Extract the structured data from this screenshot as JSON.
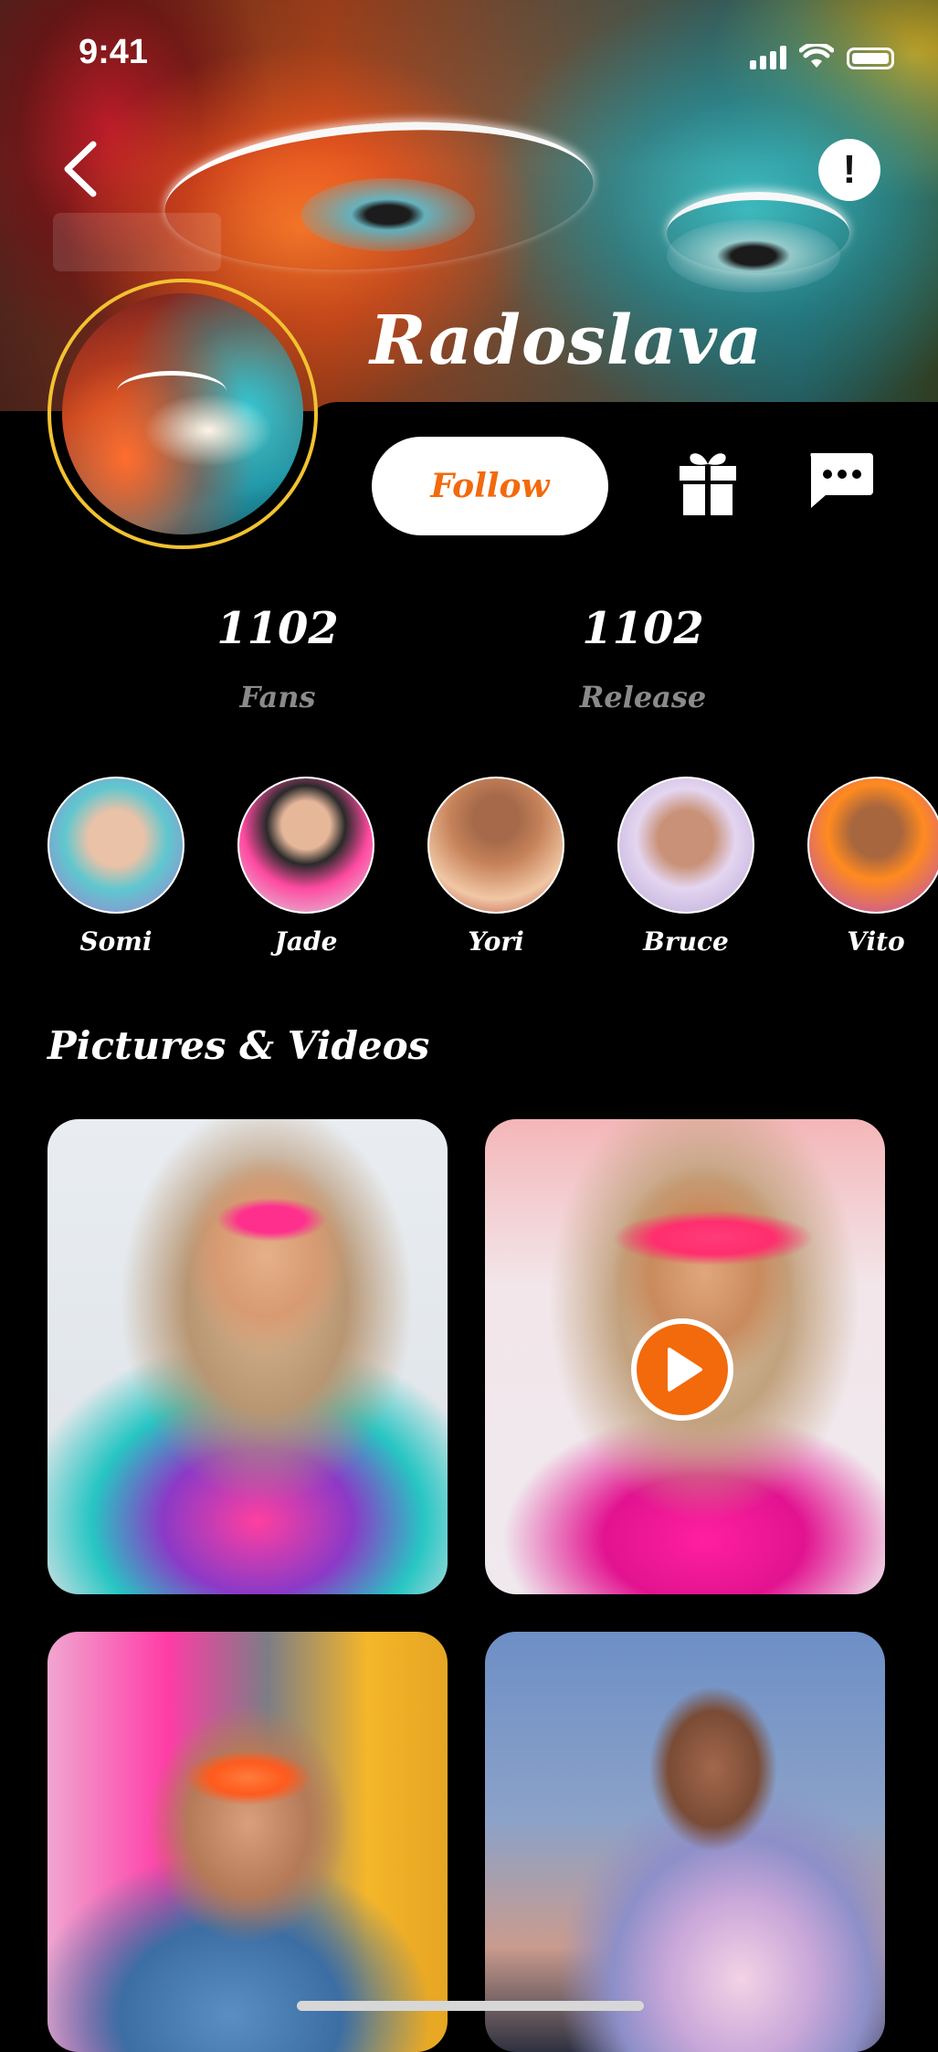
{
  "status_bar": {
    "time": "9:41"
  },
  "profile": {
    "name": "Radoslava",
    "follow_label": "Follow"
  },
  "stats": [
    {
      "value": "1102",
      "label": "Fans"
    },
    {
      "value": "1102",
      "label": "Release"
    }
  ],
  "friends": [
    {
      "name": "Somi",
      "colors": [
        "#5fc7cf",
        "#a777d0"
      ]
    },
    {
      "name": "Jade",
      "colors": [
        "#d7dfe3",
        "#ff4aa1"
      ]
    },
    {
      "name": "Yori",
      "colors": [
        "#c6825a",
        "#f1c7a5"
      ]
    },
    {
      "name": "Bruce",
      "colors": [
        "#b6a6d6",
        "#e4d5f0"
      ]
    },
    {
      "name": "Vito",
      "colors": [
        "#ff8a1f",
        "#b349c9"
      ]
    }
  ],
  "section": {
    "title": "Pictures & Videos"
  },
  "colors": {
    "accent": "#f26a0c",
    "ring": "#f2c230",
    "background": "#000000"
  }
}
